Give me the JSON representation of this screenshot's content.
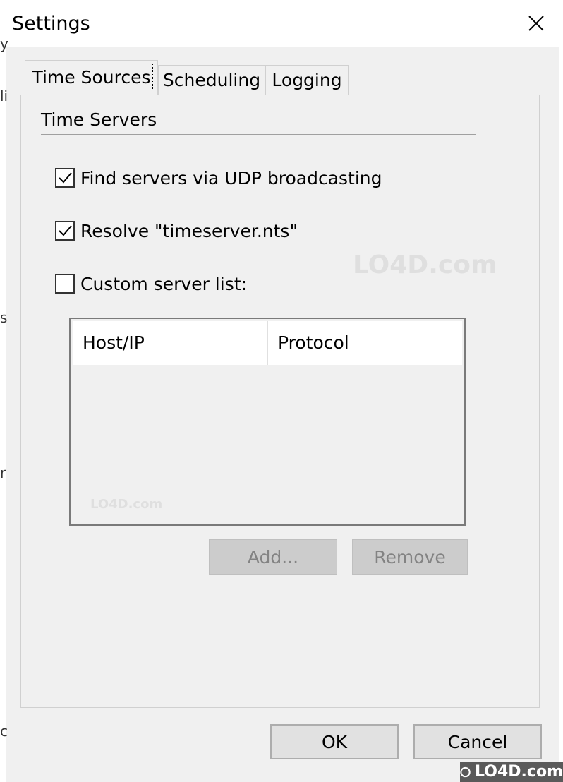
{
  "window": {
    "title": "Settings"
  },
  "background_chars": [
    "y",
    "li",
    "s",
    "r",
    "c"
  ],
  "tabs": [
    {
      "label": "Time Sources",
      "active": true
    },
    {
      "label": "Scheduling",
      "active": false
    },
    {
      "label": "Logging",
      "active": false
    }
  ],
  "group": {
    "title": "Time Servers"
  },
  "options": {
    "udp": {
      "label": "Find servers via UDP broadcasting",
      "checked": true
    },
    "resolve": {
      "label": "Resolve \"timeserver.nts\"",
      "checked": true
    },
    "custom": {
      "label": "Custom server list:",
      "checked": false
    }
  },
  "server_list": {
    "columns": [
      "Host/IP",
      "Protocol"
    ],
    "rows": []
  },
  "buttons": {
    "add": "Add...",
    "remove": "Remove",
    "ok": "OK",
    "cancel": "Cancel"
  },
  "watermark": {
    "text": "LO4D.com"
  },
  "colors": {
    "window_bg": "#f0f0f0",
    "titlebar_bg": "#ffffff",
    "disabled_button": "#cccccc",
    "button": "#e1e1e1"
  }
}
